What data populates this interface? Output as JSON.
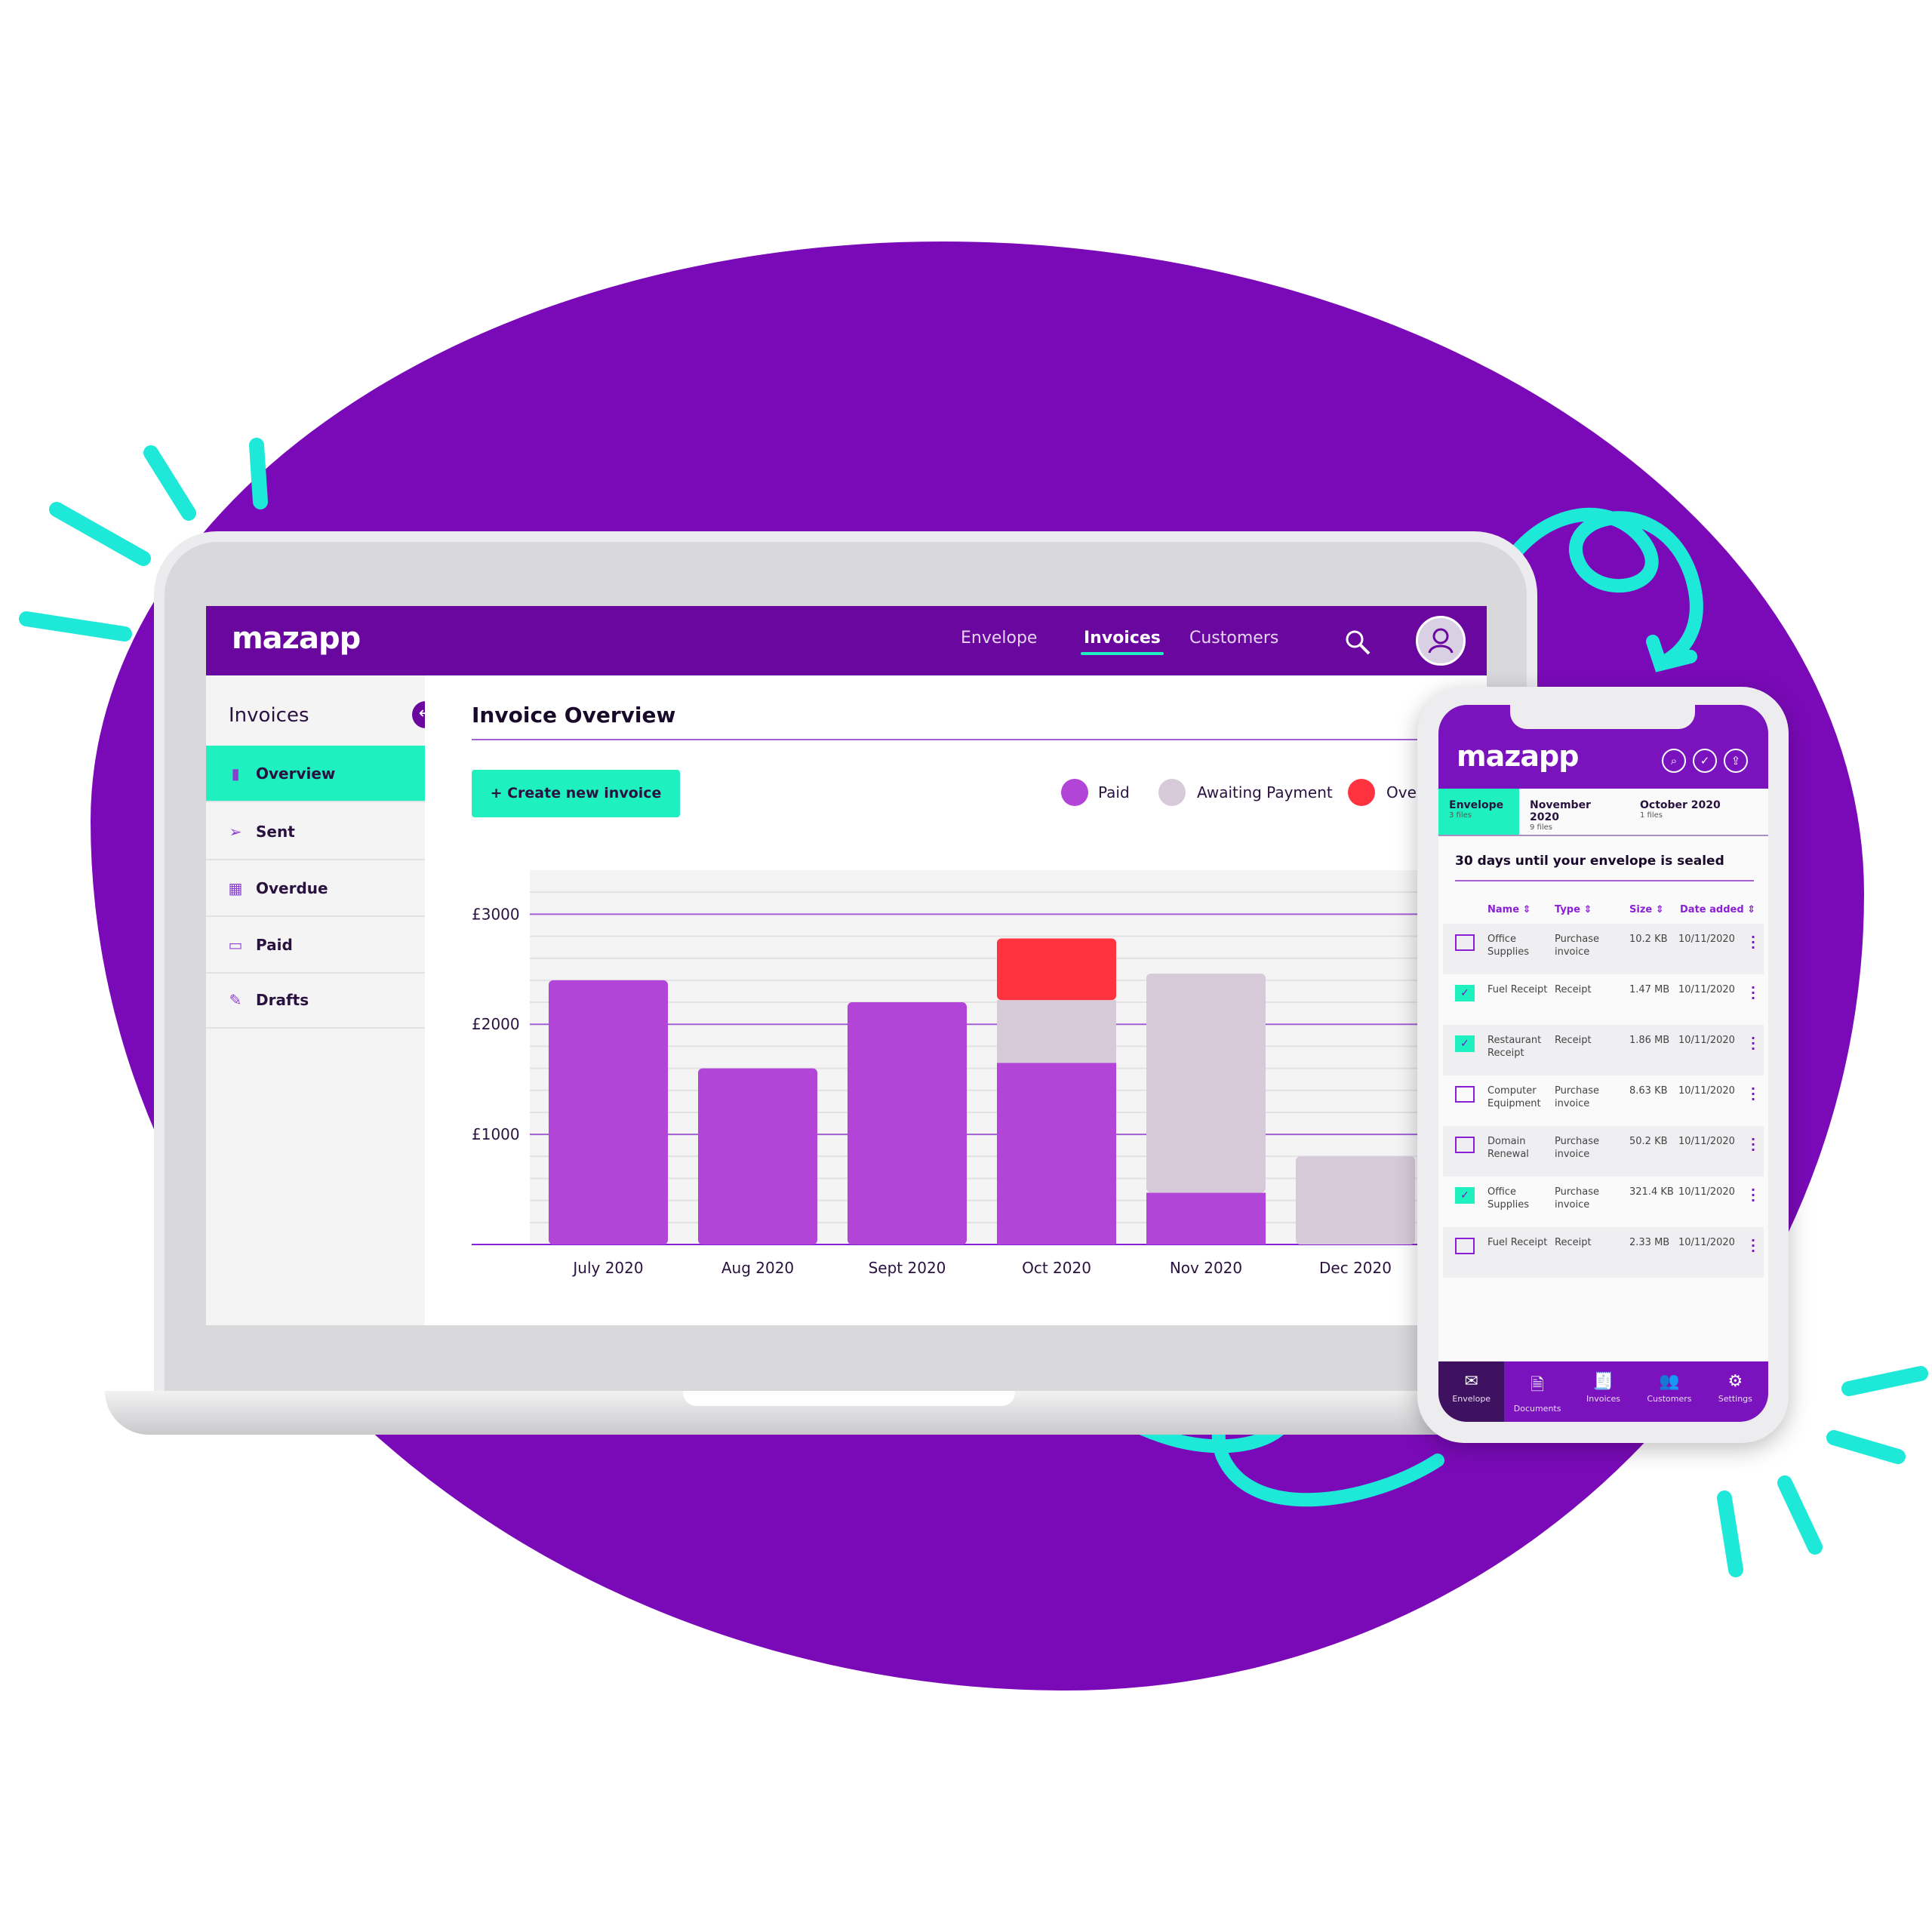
{
  "colors": {
    "brand": "#6a079f",
    "accent": "#1ef0c0",
    "paid": "#b245d8",
    "awaiting": "#d6cad9",
    "overdue": "#ff323f",
    "background_blob": "#7a0ab8"
  },
  "laptop": {
    "logo": "mazapp",
    "nav": [
      {
        "label": "Envelope",
        "active": false
      },
      {
        "label": "Invoices",
        "active": true
      },
      {
        "label": "Customers",
        "active": false
      }
    ],
    "icons": {
      "search": "search-icon",
      "avatar": "user-icon"
    },
    "sidebar": {
      "title": "Invoices",
      "items": [
        {
          "label": "Overview",
          "icon": "bar-chart-icon",
          "active": true
        },
        {
          "label": "Sent",
          "icon": "send-icon"
        },
        {
          "label": "Overdue",
          "icon": "calendar-icon"
        },
        {
          "label": "Paid",
          "icon": "credit-card-icon"
        },
        {
          "label": "Drafts",
          "icon": "document-edit-icon"
        }
      ]
    },
    "main": {
      "title": "Invoice Overview",
      "create_button": "+ Create new invoice",
      "legend": [
        "Paid",
        "Awaiting Payment",
        "Ove"
      ]
    }
  },
  "chart_data": {
    "type": "bar",
    "stacked": true,
    "categories": [
      "July 2020",
      "Aug 2020",
      "Sept 2020",
      "Oct 2020",
      "Nov 2020",
      "Dec 2020"
    ],
    "series": [
      {
        "name": "Paid",
        "values": [
          2400,
          1600,
          2200,
          1650,
          470,
          0
        ]
      },
      {
        "name": "Awaiting Payment",
        "values": [
          0,
          0,
          0,
          570,
          1990,
          800
        ]
      },
      {
        "name": "Overdue",
        "values": [
          0,
          0,
          0,
          560,
          0,
          0
        ]
      }
    ],
    "yticks": [
      "£1000",
      "£2000",
      "£3000"
    ],
    "ytick_values": [
      1000,
      2000,
      3000
    ],
    "ylim": [
      0,
      3400
    ],
    "grid": true,
    "legend": "top-right"
  },
  "phone": {
    "logo": "mazapp",
    "header_icons": [
      "search-icon",
      "check-icon",
      "upload-icon"
    ],
    "tabs": [
      {
        "label": "Envelope",
        "sub": "3 files",
        "active": true
      },
      {
        "label": "November 2020",
        "sub": "9 files"
      },
      {
        "label": "October 2020",
        "sub": "1 files"
      }
    ],
    "notice": "30 days until your envelope is sealed",
    "columns": [
      "Name",
      "Type",
      "Size",
      "Date added"
    ],
    "rows": [
      {
        "checked": false,
        "name": "Office Supplies",
        "type": "Purchase invoice",
        "size": "10.2 KB",
        "date": "10/11/2020"
      },
      {
        "checked": true,
        "name": "Fuel Receipt",
        "type": "Receipt",
        "size": "1.47 MB",
        "date": "10/11/2020"
      },
      {
        "checked": true,
        "name": "Restaurant Receipt",
        "type": "Receipt",
        "size": "1.86 MB",
        "date": "10/11/2020"
      },
      {
        "checked": false,
        "name": "Computer Equipment",
        "type": "Purchase invoice",
        "size": "8.63 KB",
        "date": "10/11/2020"
      },
      {
        "checked": false,
        "name": "Domain Renewal",
        "type": "Purchase invoice",
        "size": "50.2 KB",
        "date": "10/11/2020"
      },
      {
        "checked": true,
        "name": "Office Supplies",
        "type": "Purchase invoice",
        "size": "321.4 KB",
        "date": "10/11/2020"
      },
      {
        "checked": false,
        "name": "Fuel Receipt",
        "type": "Receipt",
        "size": "2.33 MB",
        "date": "10/11/2020"
      }
    ],
    "bottom_nav": [
      {
        "label": "Envelope",
        "icon": "envelope-icon",
        "active": true
      },
      {
        "label": "Documents",
        "icon": "document-icon"
      },
      {
        "label": "Invoices",
        "icon": "invoice-icon"
      },
      {
        "label": "Customers",
        "icon": "users-icon"
      },
      {
        "label": "Settings",
        "icon": "gear-icon"
      }
    ]
  }
}
